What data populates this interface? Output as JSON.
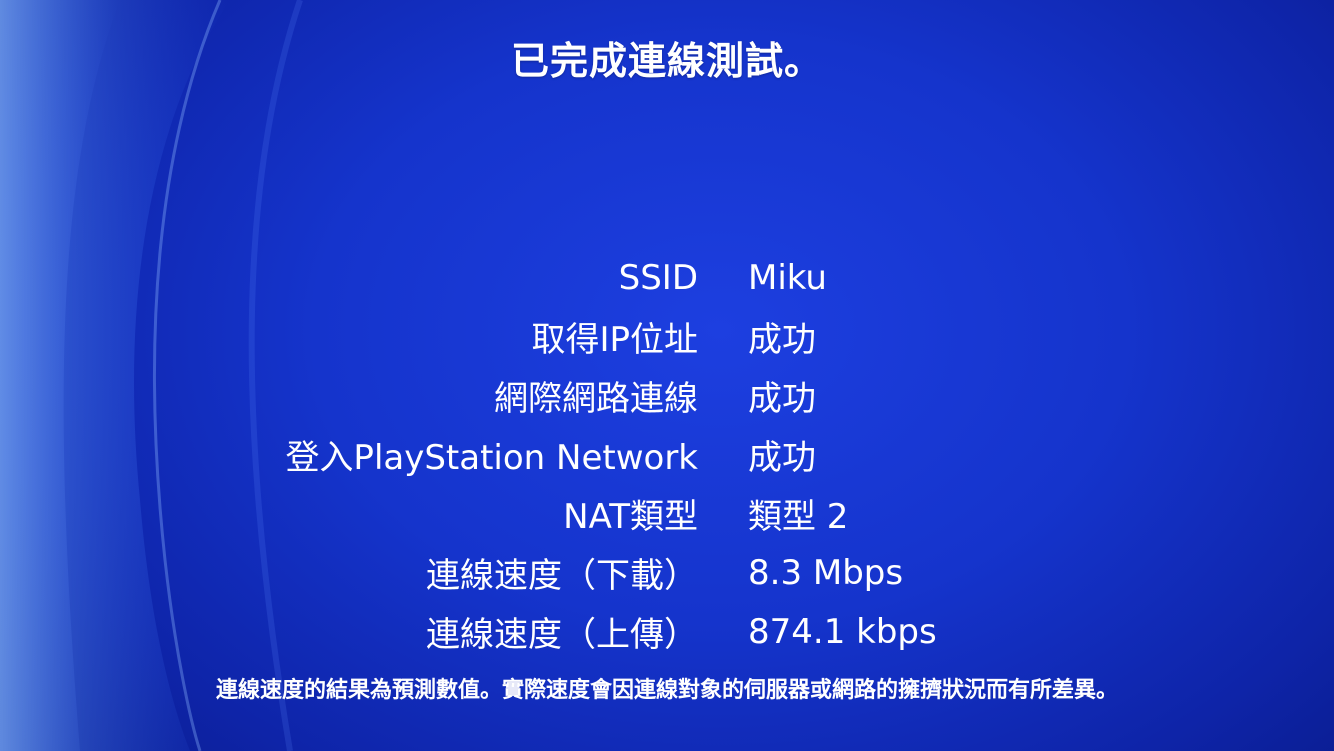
{
  "title": "已完成連線測試。",
  "rows": [
    {
      "label": "SSID",
      "value": "Miku"
    },
    {
      "label": "取得IP位址",
      "value": "成功"
    },
    {
      "label": "網際網路連線",
      "value": "成功"
    },
    {
      "label": "登入PlayStation Network",
      "value": "成功"
    },
    {
      "label": "NAT類型",
      "value": "類型 2"
    },
    {
      "label": "連線速度（下載）",
      "value": "8.3 Mbps"
    },
    {
      "label": "連線速度（上傳）",
      "value": "874.1 kbps"
    }
  ],
  "note": "連線速度的結果為預測數值。實際速度會因連線對象的伺服器或網路的擁擠狀況而有所差異。",
  "colors": {
    "background": "#1534cc",
    "text": "#ffffff"
  }
}
